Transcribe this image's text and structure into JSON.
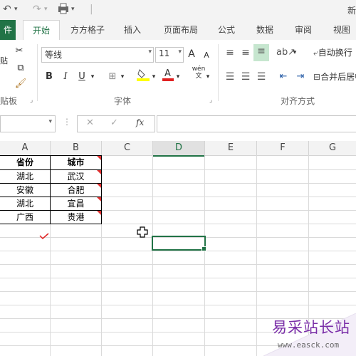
{
  "qat": {
    "undo": "↶",
    "redo": "↷",
    "doc_title": "新"
  },
  "tabs": [
    {
      "label": "件"
    },
    {
      "label": "开始"
    },
    {
      "label": "方方格子"
    },
    {
      "label": "插入"
    },
    {
      "label": "页面布局"
    },
    {
      "label": "公式"
    },
    {
      "label": "数据"
    },
    {
      "label": "审阅"
    },
    {
      "label": "视图"
    }
  ],
  "ribbon": {
    "clipboard_label": "贴板",
    "font_name": "等线",
    "font_size": "11",
    "grow_font": "A",
    "shrink_font": "A",
    "bold": "B",
    "italic": "I",
    "underline": "U",
    "font_group_label": "字体",
    "wrap_text": "自动换行",
    "merge_center": "合并后居中",
    "align_group_label": "对齐方式",
    "wen": "wén"
  },
  "formula_bar": {
    "cancel": "✕",
    "enter": "✓",
    "fx": "fx",
    "value": ""
  },
  "grid": {
    "columns": [
      "A",
      "B",
      "C",
      "D",
      "E",
      "F",
      "G"
    ],
    "selected_column": "D",
    "table_header": [
      "省份",
      "城市"
    ],
    "rows": [
      [
        "湖北",
        "武汉"
      ],
      [
        "安徽",
        "合肥"
      ],
      [
        "湖北",
        "宜昌"
      ],
      [
        "广西",
        "贵港"
      ]
    ]
  },
  "watermark": {
    "text": "易采站长站",
    "url": "www.easck.com"
  },
  "colors": {
    "accent": "#217346",
    "comment": "#e03030"
  }
}
